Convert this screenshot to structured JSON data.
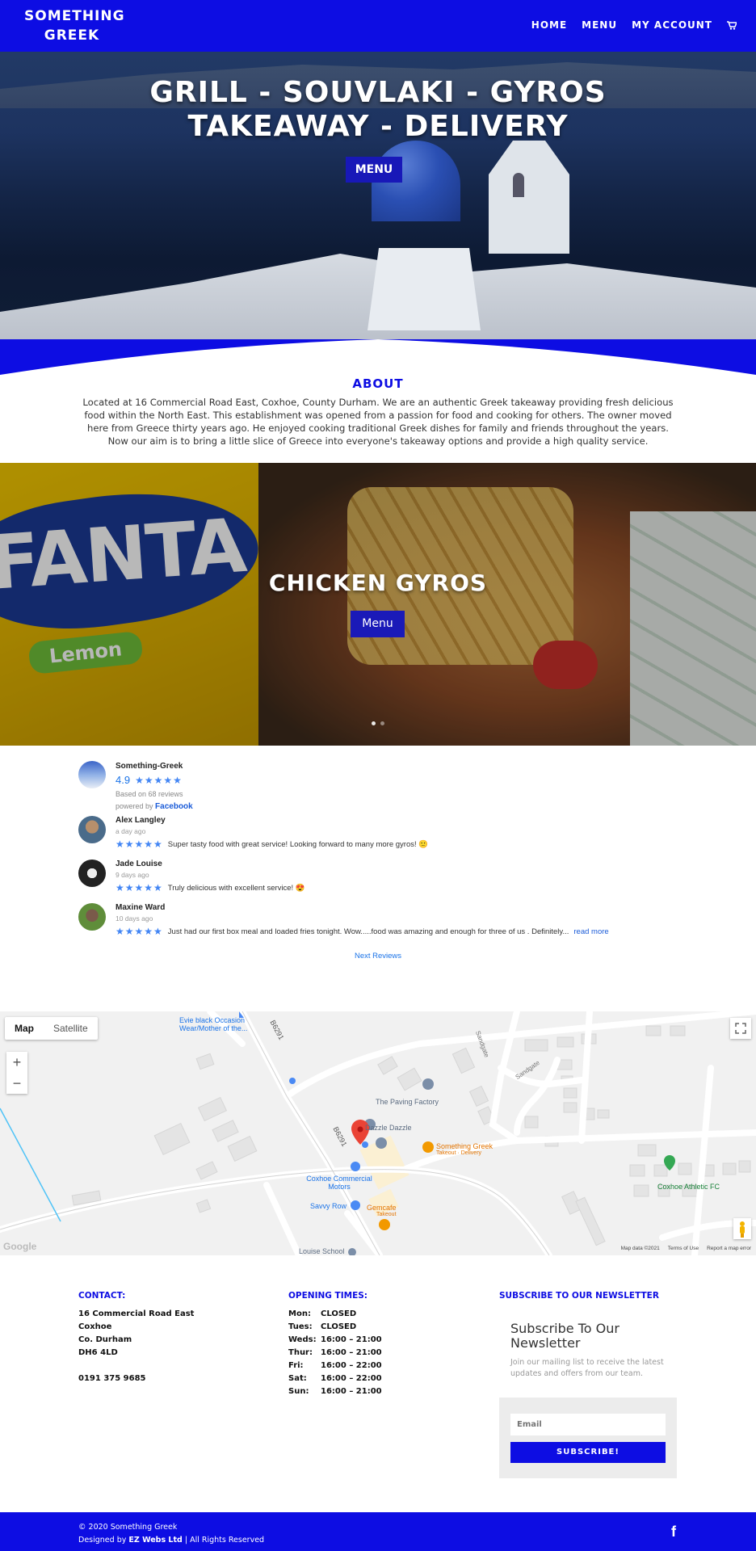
{
  "header": {
    "logo_line1": "SOMETHING",
    "logo_line2": "GREEK",
    "nav": [
      "HOME",
      "MENU",
      "MY ACCOUNT"
    ]
  },
  "hero": {
    "title_line1": "GRILL - SOUVLAKI - GYROS",
    "title_line2": "TAKEAWAY - DELIVERY",
    "button": "MENU"
  },
  "about": {
    "title": "ABOUT",
    "text": "Located at 16 Commercial Road East, Coxhoe, County Durham. We are an authentic Greek takeaway providing fresh delicious food within the North East. This establishment was opened from a passion for food and cooking for others. The owner moved here from Greece thirty years ago. He enjoyed cooking traditional Greek dishes for family and friends throughout the years. Now our aim is to bring a little slice of Greece into everyone's takeaway options and provide a high quality service."
  },
  "slider": {
    "can_word": "FANTA",
    "can_lemon": "Lemon",
    "title": "CHICKEN GYROS",
    "button": "Menu",
    "slide_count": 2,
    "active_slide": 1
  },
  "reviews": {
    "business": "Something-Greek",
    "rating": "4.9",
    "stars": "★★★★★",
    "based_on": "Based on 68 reviews",
    "powered_by": "powered by",
    "powered_brand": "Facebook",
    "items": [
      {
        "name": "Alex Langley",
        "time": "a day ago",
        "stars": "★★★★★",
        "text": "Super tasty food with great service! Looking forward to many more gyros! 🙂",
        "more": ""
      },
      {
        "name": "Jade Louise",
        "time": "9 days ago",
        "stars": "★★★★★",
        "text": "Truly delicious with excellent service! 😍",
        "more": ""
      },
      {
        "name": "Maxine Ward",
        "time": "10 days ago",
        "stars": "★★★★★",
        "text": "Just had our first box meal and loaded fries tonight. Wow.....food was amazing and enough for three of us . Definitely...",
        "more": "read more"
      }
    ],
    "next": "Next Reviews"
  },
  "map": {
    "type_map": "Map",
    "type_satellite": "Satellite",
    "zoom_in": "+",
    "zoom_out": "−",
    "labels": {
      "evie": "Evie black Occasion Wear/Mother of the...",
      "b6291_top": "B6291",
      "b6291_mid": "B6291",
      "sandgate1": "Sandgate",
      "sandgate2": "Sandgate",
      "paving": "The Paving Factory",
      "dazzle": "Dazzle Dazzle",
      "sg_name": "Something Greek",
      "sg_sub": "Takeout · Delivery",
      "coxhoe_motors": "Coxhoe Commercial Motors",
      "savvy": "Savvy Row",
      "gemcafe": "Gemcafe",
      "gemcafe_sub": "Takeout",
      "coxhoe_fc": "Coxhoe Athletic FC",
      "louise_school": "Louise School"
    },
    "google": "Google",
    "data": "Map data ©2021",
    "terms": "Terms of Use",
    "report": "Report a map error"
  },
  "contact": {
    "heading": "CONTACT:",
    "lines": [
      "16 Commercial Road East",
      "Coxhoe",
      "Co. Durham",
      "DH6 4LD"
    ],
    "phone": "0191 375 9685"
  },
  "hours": {
    "heading": "OPENING TIMES:",
    "rows": [
      {
        "day": "Mon:",
        "time": "CLOSED"
      },
      {
        "day": "Tues:",
        "time": "CLOSED"
      },
      {
        "day": "Weds:",
        "time": "16:00 – 21:00"
      },
      {
        "day": "Thur:",
        "time": "16:00 – 21:00"
      },
      {
        "day": "Fri:",
        "time": "16:00 – 22:00"
      },
      {
        "day": "Sat:",
        "time": "16:00 – 22:00"
      },
      {
        "day": "Sun:",
        "time": "16:00 – 21:00"
      }
    ]
  },
  "newsletter": {
    "heading": "SUBSCRIBE TO OUR NEWSLETTER",
    "title": "Subscribe To Our Newsletter",
    "desc": "Join our mailing list to receive the latest updates and offers from our team.",
    "placeholder": "Email",
    "button": "SUBSCRIBE!"
  },
  "footer": {
    "copyright": "© 2020 Something Greek",
    "designed_prefix": "Designed by",
    "designed_by": "EZ Webs Ltd",
    "rights": "| All Rights Reserved",
    "social": "f"
  },
  "colors": {
    "brand": "#0d0de3",
    "button": "#1a1ab8"
  }
}
